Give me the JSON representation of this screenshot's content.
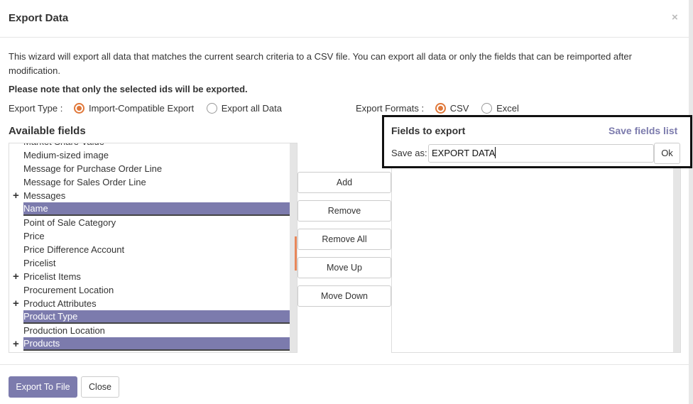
{
  "dialog": {
    "title": "Export Data",
    "close_icon": "×"
  },
  "intro": "This wizard will export all data that matches the current search criteria to a CSV file. You can export all data or only the fields that can be reimported after modification.",
  "note": "Please note that only the selected ids will be exported.",
  "export_type": {
    "label": "Export Type :",
    "options": [
      {
        "label": "Import-Compatible Export",
        "selected": true
      },
      {
        "label": "Export all Data",
        "selected": false
      }
    ]
  },
  "export_formats": {
    "label": "Export Formats :",
    "options": [
      {
        "label": "CSV",
        "selected": true
      },
      {
        "label": "Excel",
        "selected": false
      }
    ]
  },
  "available": {
    "title": "Available fields",
    "items": [
      {
        "label": "Market Share Value",
        "expandable": false,
        "selected": false
      },
      {
        "label": "Medium-sized image",
        "expandable": false,
        "selected": false
      },
      {
        "label": "Message for Purchase Order Line",
        "expandable": false,
        "selected": false
      },
      {
        "label": "Message for Sales Order Line",
        "expandable": false,
        "selected": false
      },
      {
        "label": "Messages",
        "expandable": true,
        "selected": false
      },
      {
        "label": "Name",
        "expandable": false,
        "selected": true
      },
      {
        "label": "Point of Sale Category",
        "expandable": false,
        "selected": false
      },
      {
        "label": "Price",
        "expandable": false,
        "selected": false
      },
      {
        "label": "Price Difference Account",
        "expandable": false,
        "selected": false
      },
      {
        "label": "Pricelist",
        "expandable": false,
        "selected": false
      },
      {
        "label": "Pricelist Items",
        "expandable": true,
        "selected": false
      },
      {
        "label": "Procurement Location",
        "expandable": false,
        "selected": false
      },
      {
        "label": "Product Attributes",
        "expandable": true,
        "selected": false
      },
      {
        "label": "Product Type",
        "expandable": false,
        "selected": true
      },
      {
        "label": "Production Location",
        "expandable": false,
        "selected": false
      },
      {
        "label": "Products",
        "expandable": true,
        "selected": true
      }
    ]
  },
  "actions": {
    "add": "Add",
    "remove": "Remove",
    "remove_all": "Remove All",
    "move_up": "Move Up",
    "move_down": "Move Down"
  },
  "fields_to_export": {
    "title": "Fields to export",
    "save_list": "Save fields list",
    "save_as_label": "Save as:",
    "save_as_value": "EXPORT DATA",
    "ok": "Ok"
  },
  "footer": {
    "export": "Export To File",
    "close": "Close"
  },
  "colors": {
    "accent": "#7c7bad",
    "radio": "#e0783a"
  }
}
